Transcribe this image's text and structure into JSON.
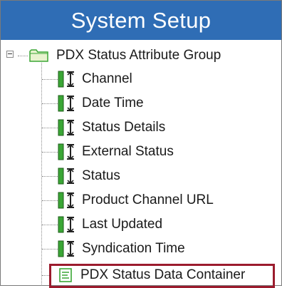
{
  "header": {
    "title": "System Setup"
  },
  "tree": {
    "root": {
      "label": "PDX Status Attribute Group",
      "icon": "folder-icon",
      "expanded": true
    },
    "attributes": [
      {
        "label": "Channel",
        "icon": "attribute-icon"
      },
      {
        "label": "Date Time",
        "icon": "attribute-icon"
      },
      {
        "label": "Status Details",
        "icon": "attribute-icon"
      },
      {
        "label": "External Status",
        "icon": "attribute-icon"
      },
      {
        "label": "Status",
        "icon": "attribute-icon"
      },
      {
        "label": "Product Channel URL",
        "icon": "attribute-icon"
      },
      {
        "label": "Last Updated",
        "icon": "attribute-icon"
      },
      {
        "label": "Syndication Time",
        "icon": "attribute-icon"
      }
    ],
    "container": {
      "label": "PDX Status Data Container",
      "icon": "data-container-icon",
      "highlighted": true
    }
  },
  "colors": {
    "header_bg": "#2f6db5",
    "header_text": "#ffffff",
    "highlight_border": "#9b1b2d",
    "icon_green": "#3aa635",
    "folder_fill": "#cfe8a6"
  }
}
